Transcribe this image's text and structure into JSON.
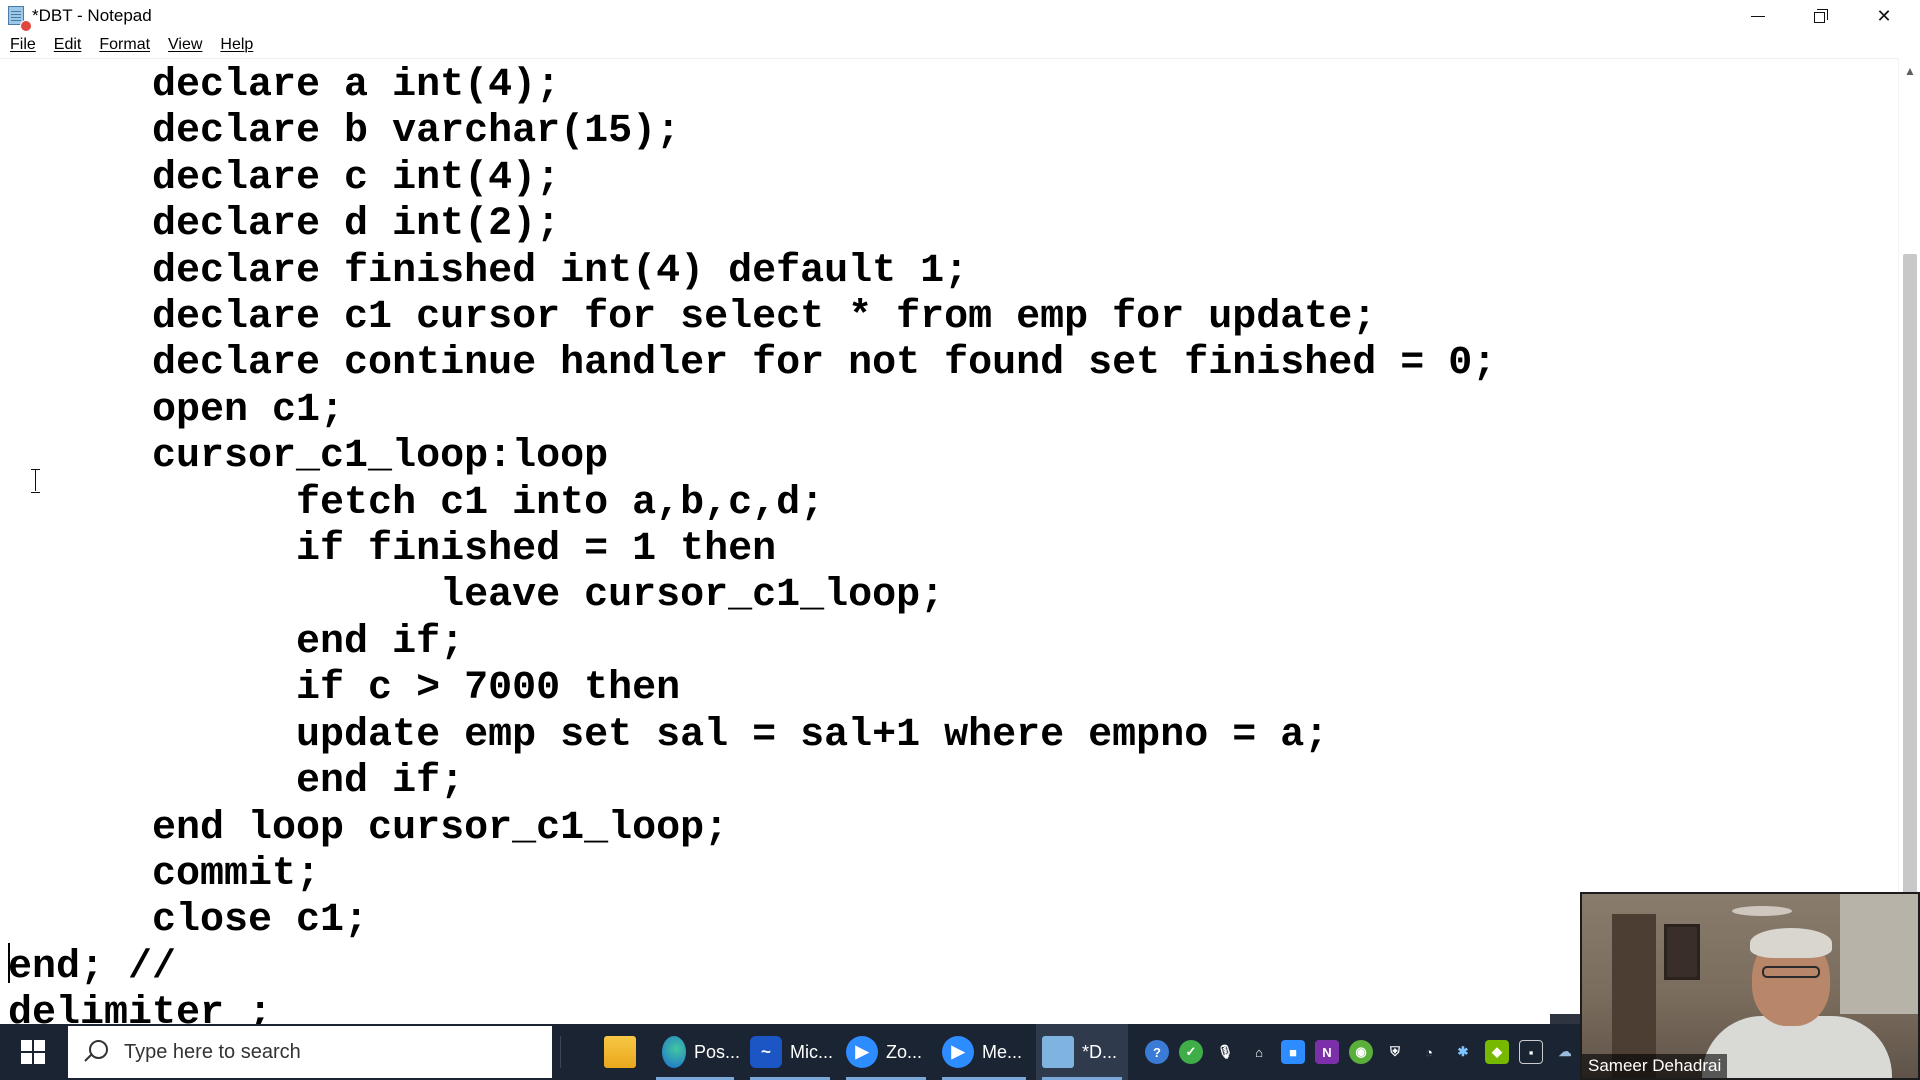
{
  "window": {
    "title": "*DBT - Notepad",
    "controls": {
      "minimize": "minimize",
      "maximize": "restore",
      "close": "close"
    }
  },
  "menu": {
    "items": [
      {
        "label": "File"
      },
      {
        "label": "Edit"
      },
      {
        "label": "Format"
      },
      {
        "label": "View"
      },
      {
        "label": "Help"
      }
    ]
  },
  "editor": {
    "lines": [
      "      declare a int(4);",
      "      declare b varchar(15);",
      "      declare c int(4);",
      "      declare d int(2);",
      "      declare finished int(4) default 1;",
      "      declare c1 cursor for select * from emp for update;",
      "      declare continue handler for not found set finished = 0;",
      "      open c1;",
      "      cursor_c1_loop:loop",
      "            fetch c1 into a,b,c,d;",
      "            if finished = 1 then",
      "                  leave cursor_c1_loop;",
      "            end if;",
      "            if c > 7000 then",
      "            update emp set sal = sal+1 where empno = a;",
      "            end if;",
      "      end loop cursor_c1_loop;",
      "      commit;",
      "      close c1;",
      "end; //",
      "delimiter ;"
    ]
  },
  "taskbar": {
    "search_placeholder": "Type here to search",
    "apps": [
      {
        "name": "file-explorer",
        "label": "",
        "icon": "folder-icon"
      },
      {
        "name": "edge-postman",
        "label": "Pos...",
        "icon": "edge-icon"
      },
      {
        "name": "microsoft-whiteboard",
        "label": "Mic...",
        "icon": "whiteboard-icon"
      },
      {
        "name": "zoom-1",
        "label": "Zo...",
        "icon": "zoom-icon"
      },
      {
        "name": "zoom-meeting",
        "label": "Me...",
        "icon": "zoom-icon"
      },
      {
        "name": "notepad",
        "label": "*D...",
        "icon": "notepad-icon"
      }
    ],
    "tray": [
      "help-icon",
      "check-icon",
      "microphone-icon",
      "tag-icon",
      "camera-icon",
      "onenote-icon",
      "globe-icon",
      "shield-icon",
      "wifi-icon",
      "bluetooth-icon",
      "nvidia-icon",
      "screen-icon",
      "cloud-icon"
    ]
  },
  "webcam": {
    "name": "Sameer Dehadrai"
  },
  "colors": {
    "taskbar": "#1b2433",
    "accent": "#7aa8d8"
  }
}
